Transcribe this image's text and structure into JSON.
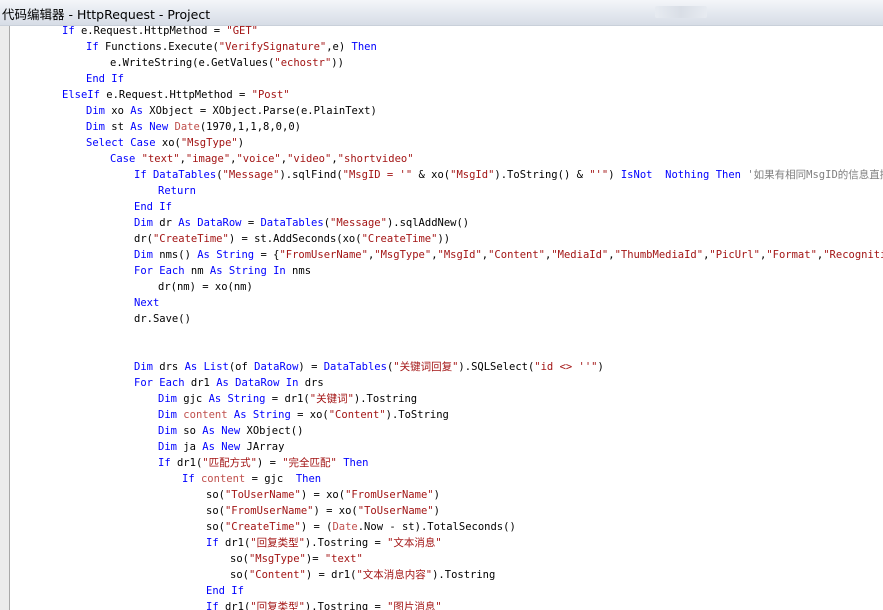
{
  "window": {
    "title": "代码编辑器 - HttpRequest - Project"
  },
  "editor": {
    "colors": {
      "kw": "#0000ff",
      "str": "#a31515",
      "cm": "#808080",
      "fn": "#c0504d",
      "tx": "#000000"
    },
    "lines": [
      {
        "indent": 0,
        "tokens": [
          [
            "kw",
            "If"
          ],
          [
            "tx",
            " e.Request.HttpMethod = "
          ],
          [
            "str",
            "\"GET\""
          ]
        ]
      },
      {
        "indent": 1,
        "tokens": [
          [
            "kw",
            "If"
          ],
          [
            "tx",
            " Functions.Execute("
          ],
          [
            "str",
            "\"VerifySignature\""
          ],
          [
            "tx",
            ",e) "
          ],
          [
            "kw",
            "Then"
          ]
        ]
      },
      {
        "indent": 2,
        "tokens": [
          [
            "tx",
            "e.WriteString(e.GetValues("
          ],
          [
            "str",
            "\"echostr\""
          ],
          [
            "tx",
            "))"
          ]
        ]
      },
      {
        "indent": 1,
        "tokens": [
          [
            "kw",
            "End If"
          ]
        ]
      },
      {
        "indent": 0,
        "tokens": [
          [
            "kw",
            "ElseIf"
          ],
          [
            "tx",
            " e.Request.HttpMethod = "
          ],
          [
            "str",
            "\"Post\""
          ]
        ]
      },
      {
        "indent": 1,
        "tokens": [
          [
            "kw",
            "Dim"
          ],
          [
            "tx",
            " xo "
          ],
          [
            "kw",
            "As"
          ],
          [
            "tx",
            " XObject = XObject.Parse(e.PlainText)"
          ]
        ]
      },
      {
        "indent": 1,
        "tokens": [
          [
            "kw",
            "Dim"
          ],
          [
            "tx",
            " st "
          ],
          [
            "kw",
            "As New"
          ],
          [
            "tx",
            " "
          ],
          [
            "fn",
            "Date"
          ],
          [
            "tx",
            "(1970,1,1,8,0,0)"
          ]
        ]
      },
      {
        "indent": 1,
        "tokens": [
          [
            "kw",
            "Select Case"
          ],
          [
            "tx",
            " xo("
          ],
          [
            "str",
            "\"MsgType\""
          ],
          [
            "tx",
            ")"
          ]
        ]
      },
      {
        "indent": 2,
        "tokens": [
          [
            "kw",
            "Case"
          ],
          [
            "tx",
            " "
          ],
          [
            "str",
            "\"text\""
          ],
          [
            "tx",
            ","
          ],
          [
            "str",
            "\"image\""
          ],
          [
            "tx",
            ","
          ],
          [
            "str",
            "\"voice\""
          ],
          [
            "tx",
            ","
          ],
          [
            "str",
            "\"video\""
          ],
          [
            "tx",
            ","
          ],
          [
            "str",
            "\"shortvideo\""
          ]
        ]
      },
      {
        "indent": 3,
        "tokens": [
          [
            "kw",
            "If"
          ],
          [
            "tx",
            " "
          ],
          [
            "kw",
            "DataTables"
          ],
          [
            "tx",
            "("
          ],
          [
            "str",
            "\"Message\""
          ],
          [
            "tx",
            ").sqlFind("
          ],
          [
            "str",
            "\"MsgID = '\""
          ],
          [
            "tx",
            " & xo("
          ],
          [
            "str",
            "\"MsgId\""
          ],
          [
            "tx",
            ").ToString() & "
          ],
          [
            "str",
            "\"'\""
          ],
          [
            "tx",
            ") "
          ],
          [
            "kw",
            "IsNot"
          ],
          [
            "tx",
            "  "
          ],
          [
            "kw",
            "Nothing"
          ],
          [
            "tx",
            " "
          ],
          [
            "kw",
            "Then"
          ],
          [
            "tx",
            " "
          ],
          [
            "cm",
            "'如果有相同MsgID的信息直接返回"
          ]
        ]
      },
      {
        "indent": 4,
        "tokens": [
          [
            "kw",
            "Return"
          ]
        ]
      },
      {
        "indent": 3,
        "tokens": [
          [
            "kw",
            "End If"
          ]
        ]
      },
      {
        "indent": 3,
        "tokens": [
          [
            "kw",
            "Dim"
          ],
          [
            "tx",
            " dr "
          ],
          [
            "kw",
            "As"
          ],
          [
            "tx",
            " "
          ],
          [
            "kw",
            "DataRow"
          ],
          [
            "tx",
            " = "
          ],
          [
            "kw",
            "DataTables"
          ],
          [
            "tx",
            "("
          ],
          [
            "str",
            "\"Message\""
          ],
          [
            "tx",
            ").sqlAddNew()"
          ]
        ]
      },
      {
        "indent": 3,
        "tokens": [
          [
            "tx",
            "dr("
          ],
          [
            "str",
            "\"CreateTime\""
          ],
          [
            "tx",
            ") = st.AddSeconds(xo("
          ],
          [
            "str",
            "\"CreateTime\""
          ],
          [
            "tx",
            "))"
          ]
        ]
      },
      {
        "indent": 3,
        "tokens": [
          [
            "kw",
            "Dim"
          ],
          [
            "tx",
            " nms() "
          ],
          [
            "kw",
            "As String"
          ],
          [
            "tx",
            " = {"
          ],
          [
            "str",
            "\"FromUserName\""
          ],
          [
            "tx",
            ","
          ],
          [
            "str",
            "\"MsgType\""
          ],
          [
            "tx",
            ","
          ],
          [
            "str",
            "\"MsgId\""
          ],
          [
            "tx",
            ","
          ],
          [
            "str",
            "\"Content\""
          ],
          [
            "tx",
            ","
          ],
          [
            "str",
            "\"MediaId\""
          ],
          [
            "tx",
            ","
          ],
          [
            "str",
            "\"ThumbMediaId\""
          ],
          [
            "tx",
            ","
          ],
          [
            "str",
            "\"PicUrl\""
          ],
          [
            "tx",
            ","
          ],
          [
            "str",
            "\"Format\""
          ],
          [
            "tx",
            ","
          ],
          [
            "str",
            "\"Recognition\""
          ],
          [
            "tx",
            "}"
          ]
        ]
      },
      {
        "indent": 3,
        "tokens": [
          [
            "kw",
            "For Each"
          ],
          [
            "tx",
            " nm "
          ],
          [
            "kw",
            "As String In"
          ],
          [
            "tx",
            " nms"
          ]
        ]
      },
      {
        "indent": 4,
        "tokens": [
          [
            "tx",
            "dr(nm) = xo(nm)"
          ]
        ]
      },
      {
        "indent": 3,
        "tokens": [
          [
            "kw",
            "Next"
          ]
        ]
      },
      {
        "indent": 3,
        "tokens": [
          [
            "tx",
            "dr.Save()"
          ]
        ]
      },
      {
        "indent": 0,
        "tokens": []
      },
      {
        "indent": 0,
        "tokens": []
      },
      {
        "indent": 3,
        "tokens": [
          [
            "kw",
            "Dim"
          ],
          [
            "tx",
            " drs "
          ],
          [
            "kw",
            "As"
          ],
          [
            "tx",
            " "
          ],
          [
            "kw",
            "List"
          ],
          [
            "tx",
            "(of "
          ],
          [
            "kw",
            "DataRow"
          ],
          [
            "tx",
            ") = "
          ],
          [
            "kw",
            "DataTables"
          ],
          [
            "tx",
            "("
          ],
          [
            "str",
            "\"关键词回复\""
          ],
          [
            "tx",
            ").SQLSelect("
          ],
          [
            "str",
            "\"id <> ''\""
          ],
          [
            "tx",
            ")"
          ]
        ]
      },
      {
        "indent": 3,
        "tokens": [
          [
            "kw",
            "For Each"
          ],
          [
            "tx",
            " dr1 "
          ],
          [
            "kw",
            "As"
          ],
          [
            "tx",
            " "
          ],
          [
            "kw",
            "DataRow In"
          ],
          [
            "tx",
            " drs"
          ]
        ]
      },
      {
        "indent": 4,
        "tokens": [
          [
            "kw",
            "Dim"
          ],
          [
            "tx",
            " gjc "
          ],
          [
            "kw",
            "As String"
          ],
          [
            "tx",
            " = dr1("
          ],
          [
            "str",
            "\"关键词\""
          ],
          [
            "tx",
            ").Tostring"
          ]
        ]
      },
      {
        "indent": 4,
        "tokens": [
          [
            "kw",
            "Dim"
          ],
          [
            "tx",
            " "
          ],
          [
            "fn",
            "content"
          ],
          [
            "tx",
            " "
          ],
          [
            "kw",
            "As String"
          ],
          [
            "tx",
            " = xo("
          ],
          [
            "str",
            "\"Content\""
          ],
          [
            "tx",
            ").ToString"
          ]
        ]
      },
      {
        "indent": 4,
        "tokens": [
          [
            "kw",
            "Dim"
          ],
          [
            "tx",
            " so "
          ],
          [
            "kw",
            "As New"
          ],
          [
            "tx",
            " XObject()"
          ]
        ]
      },
      {
        "indent": 4,
        "tokens": [
          [
            "kw",
            "Dim"
          ],
          [
            "tx",
            " ja "
          ],
          [
            "kw",
            "As New"
          ],
          [
            "tx",
            " JArray"
          ]
        ]
      },
      {
        "indent": 4,
        "tokens": [
          [
            "kw",
            "If"
          ],
          [
            "tx",
            " dr1("
          ],
          [
            "str",
            "\"匹配方式\""
          ],
          [
            "tx",
            ") = "
          ],
          [
            "str",
            "\"完全匹配\""
          ],
          [
            "tx",
            " "
          ],
          [
            "kw",
            "Then"
          ]
        ]
      },
      {
        "indent": 5,
        "tokens": [
          [
            "kw",
            "If"
          ],
          [
            "tx",
            " "
          ],
          [
            "fn",
            "content"
          ],
          [
            "tx",
            " = gjc  "
          ],
          [
            "kw",
            "Then"
          ]
        ]
      },
      {
        "indent": 6,
        "tokens": [
          [
            "tx",
            "so("
          ],
          [
            "str",
            "\"ToUserName\""
          ],
          [
            "tx",
            ") = xo("
          ],
          [
            "str",
            "\"FromUserName\""
          ],
          [
            "tx",
            ")"
          ]
        ]
      },
      {
        "indent": 6,
        "tokens": [
          [
            "tx",
            "so("
          ],
          [
            "str",
            "\"FromUserName\""
          ],
          [
            "tx",
            ") = xo("
          ],
          [
            "str",
            "\"ToUserName\""
          ],
          [
            "tx",
            ")"
          ]
        ]
      },
      {
        "indent": 6,
        "tokens": [
          [
            "tx",
            "so("
          ],
          [
            "str",
            "\"CreateTime\""
          ],
          [
            "tx",
            ") = ("
          ],
          [
            "fn",
            "Date"
          ],
          [
            "tx",
            ".Now - st).TotalSeconds()"
          ]
        ]
      },
      {
        "indent": 6,
        "tokens": [
          [
            "kw",
            "If"
          ],
          [
            "tx",
            " dr1("
          ],
          [
            "str",
            "\"回复类型\""
          ],
          [
            "tx",
            ").Tostring = "
          ],
          [
            "str",
            "\"文本消息\""
          ]
        ]
      },
      {
        "indent": 7,
        "tokens": [
          [
            "tx",
            "so("
          ],
          [
            "str",
            "\"MsgType\""
          ],
          [
            "tx",
            ")= "
          ],
          [
            "str",
            "\"text\""
          ]
        ]
      },
      {
        "indent": 7,
        "tokens": [
          [
            "tx",
            "so("
          ],
          [
            "str",
            "\"Content\""
          ],
          [
            "tx",
            ") = dr1("
          ],
          [
            "str",
            "\"文本消息内容\""
          ],
          [
            "tx",
            ").Tostring"
          ]
        ]
      },
      {
        "indent": 6,
        "tokens": [
          [
            "kw",
            "End If"
          ]
        ]
      },
      {
        "indent": 6,
        "tokens": [
          [
            "kw",
            "If"
          ],
          [
            "tx",
            " dr1("
          ],
          [
            "str",
            "\"回复类型\""
          ],
          [
            "tx",
            ").Tostring = "
          ],
          [
            "str",
            "\"图片消息\""
          ]
        ]
      }
    ]
  }
}
